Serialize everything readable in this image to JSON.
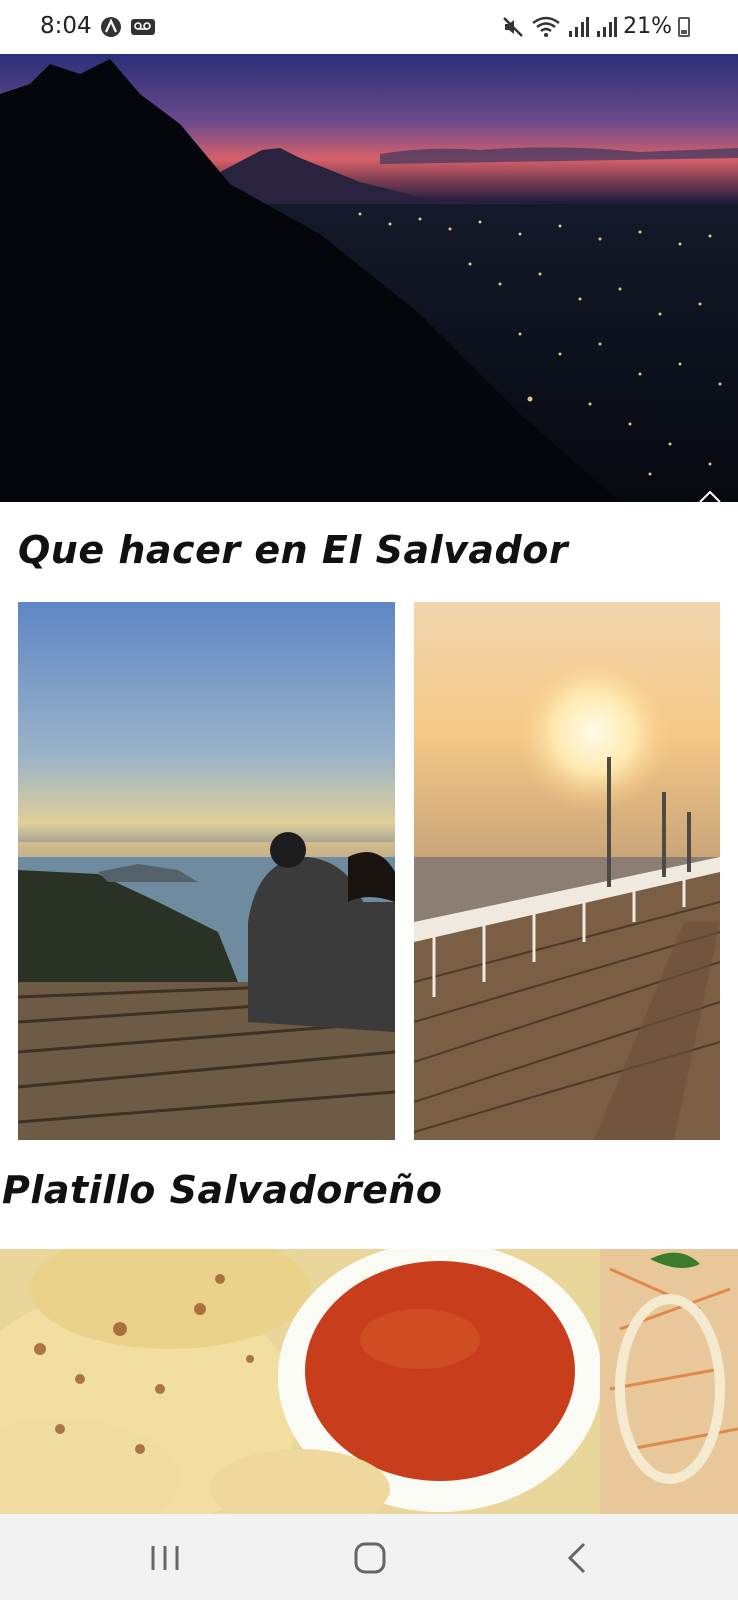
{
  "status_bar": {
    "time": "8:04",
    "battery_percent": "21%",
    "icons": [
      "app-a-icon",
      "voicemail-icon",
      "mute-icon",
      "wifi-icon",
      "signal-icon",
      "signal-icon",
      "battery-icon"
    ]
  },
  "sections": {
    "things_to_do_title": "Que hacer en El Salvador",
    "dish_title": "Platillo Salvadoreño"
  },
  "nav_bar": {
    "icons": [
      "recent-apps-icon",
      "home-icon",
      "back-icon"
    ]
  }
}
